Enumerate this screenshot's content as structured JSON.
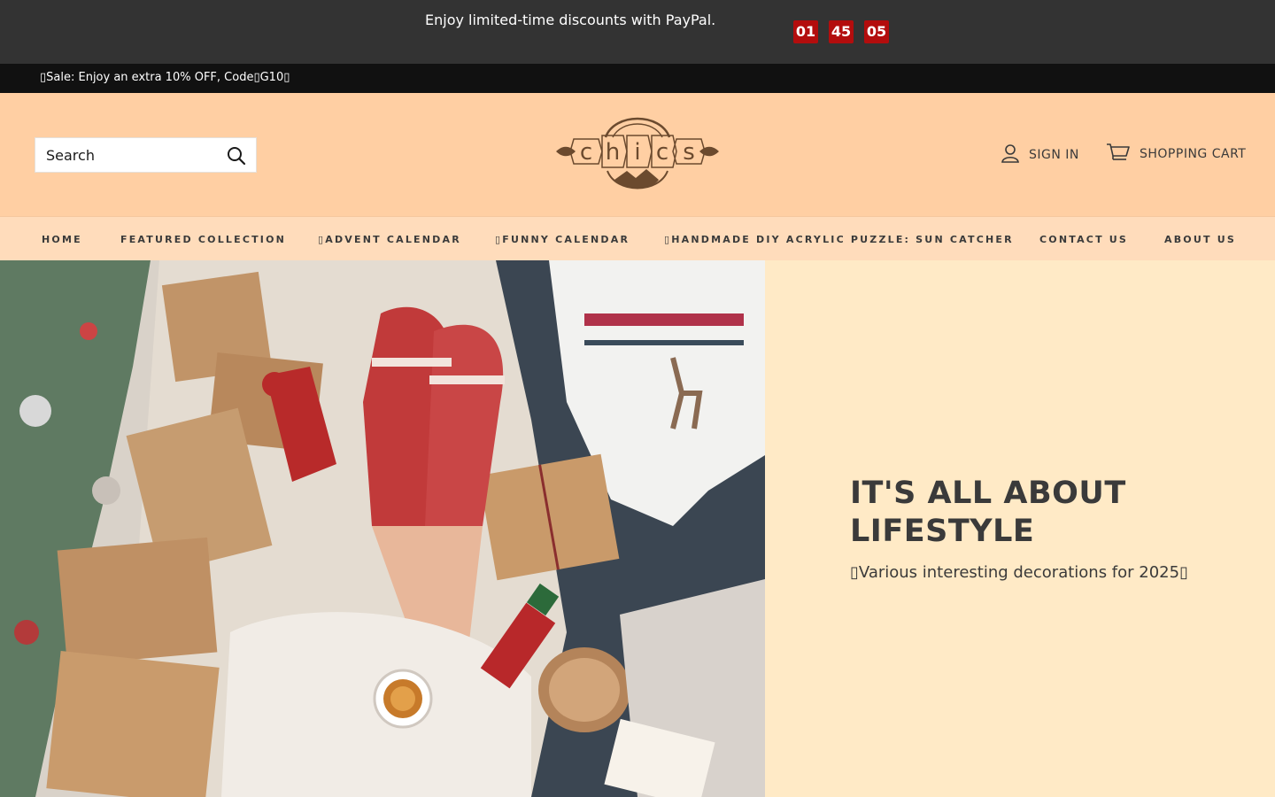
{
  "promo": {
    "text": "Enjoy limited-time discounts with PayPal.",
    "countdown": {
      "hours": "01",
      "minutes": "45",
      "seconds": "05"
    }
  },
  "announcement": {
    "text": "▯Sale: Enjoy an extra 10% OFF, Code▯G10▯"
  },
  "header": {
    "search": {
      "placeholder": "Search",
      "icon": "search-icon"
    },
    "logo": {
      "text": "chics",
      "letters": [
        "c",
        "h",
        "i",
        "c",
        "s"
      ]
    },
    "sign_in": {
      "label": "SIGN IN",
      "icon": "user-icon"
    },
    "cart": {
      "label": "SHOPPING CART",
      "icon": "cart-icon"
    }
  },
  "nav": {
    "items": [
      {
        "label": "HOME"
      },
      {
        "label": "FEATURED COLLECTION"
      },
      {
        "label": "▯ADVENT CALENDAR"
      },
      {
        "label": "▯FUNNY CALENDAR"
      },
      {
        "label": "▯HANDMADE DIY ACRYLIC PUZZLE: SUN CATCHER"
      },
      {
        "label": "CONTACT US"
      },
      {
        "label": "ABOUT US"
      }
    ]
  },
  "hero": {
    "title": "IT'S ALL ABOUT LIFESTYLE",
    "subtitle": "▯Various interesting decorations for 2025▯"
  },
  "colors": {
    "promo_bg": "#333333",
    "announce_bg": "#111111",
    "header_bg": "#ffcfa3",
    "nav_bg": "#ffdcbb",
    "hero_panel_bg": "#ffeac6",
    "countdown_bg": "#b30d0d",
    "logo_brown": "#6b4a2e"
  }
}
